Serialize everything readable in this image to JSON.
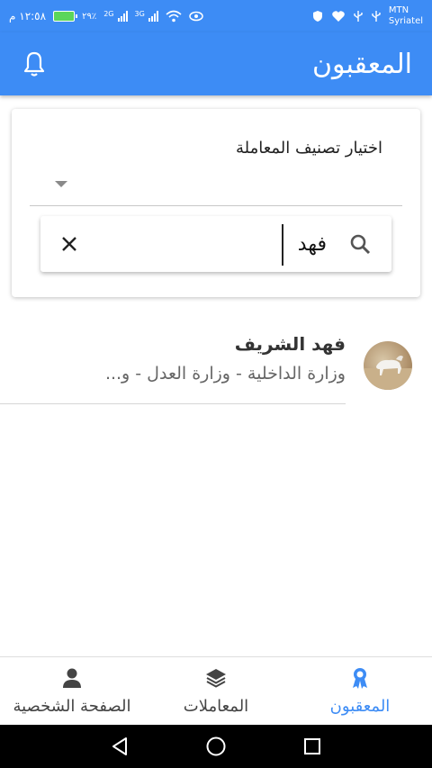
{
  "status_bar": {
    "time": "١٢:٥٨ م",
    "battery_percent": "٢٩٪",
    "network_tag_1": "2G",
    "network_tag_2": "3G",
    "carrier_1": "MTN",
    "carrier_2": "Syriatel"
  },
  "app_bar": {
    "title": "المعقبون",
    "bell_icon": "bell-icon"
  },
  "filter": {
    "label": "اختيار تصنيف المعاملة",
    "selected": ""
  },
  "search": {
    "value": "فهد",
    "search_icon": "search-icon",
    "clear_icon": "close-icon"
  },
  "results": [
    {
      "name": "فهد الشريف",
      "subtitle": "وزارة الداخلية - وزارة العدل - و..."
    }
  ],
  "bottom_nav": {
    "items": [
      {
        "label": "الصفحة الشخصية",
        "icon": "person-icon",
        "active": false
      },
      {
        "label": "المعاملات",
        "icon": "layers-icon",
        "active": false
      },
      {
        "label": "المعقبون",
        "icon": "award-icon",
        "active": true
      }
    ]
  },
  "colors": {
    "primary": "#3d8cf5",
    "text_dark": "#333333",
    "text_muted": "#666666"
  }
}
